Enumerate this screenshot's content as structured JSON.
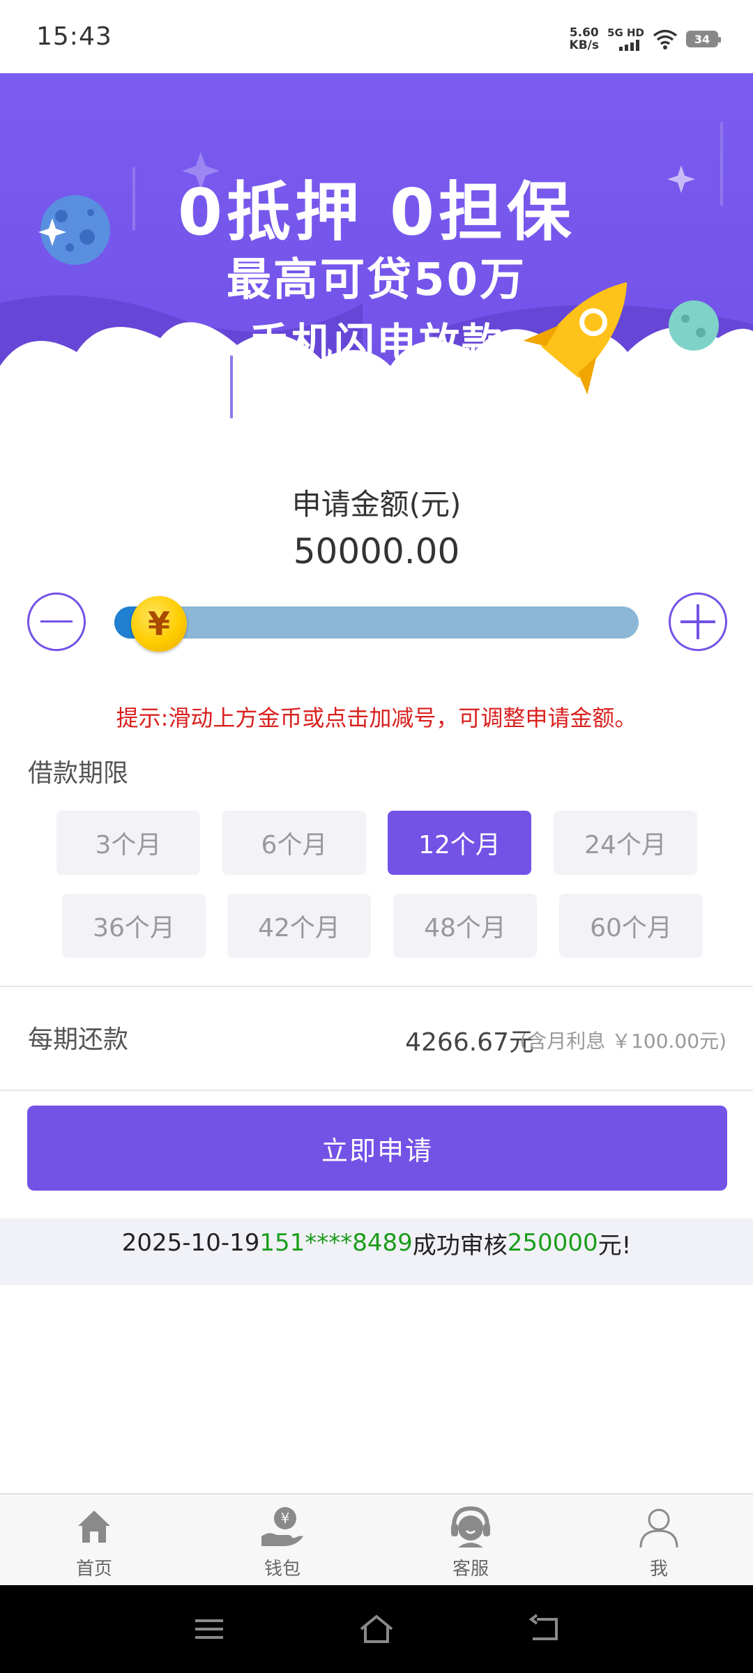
{
  "status_bar": {
    "time": "15:43",
    "net_speed_value": "5.60",
    "net_speed_unit": "KB/s",
    "signal_label": "5G HD",
    "battery": "34"
  },
  "banner": {
    "line1": "0抵押 0担保",
    "line2": "最高可贷50万",
    "line3": "手机闪电放款"
  },
  "amount": {
    "title": "申请金额(元)",
    "value": "50000.00",
    "slider_fraction": 0.0,
    "coin_symbol": "¥"
  },
  "tip": "提示:滑动上方金币或点击加减号，可调整申请金额。",
  "term": {
    "title": "借款期限",
    "options": [
      "3个月",
      "6个月",
      "12个月",
      "24个月",
      "36个月",
      "42个月",
      "48个月",
      "60个月"
    ],
    "selected": "12个月"
  },
  "payment": {
    "label": "每期还款",
    "value": "4266.67元",
    "interest": "(含月利息 ￥100.00元)"
  },
  "apply_button": "立即申请",
  "notice": {
    "date": "2025-10-19",
    "phone": "151****8489",
    "action": "成功审核",
    "amount": "250000",
    "suffix": "元!"
  },
  "tab_bar": {
    "items": [
      {
        "label": "首页",
        "icon": "home-icon"
      },
      {
        "label": "钱包",
        "icon": "wallet-icon"
      },
      {
        "label": "客服",
        "icon": "customer-service-icon"
      },
      {
        "label": "我",
        "icon": "user-icon"
      }
    ]
  },
  "colors": {
    "accent": "#7352e6",
    "tip": "#d9201e",
    "highlight_green": "#1a9d1a",
    "slider_track": "#8bb6d6",
    "coin": "#ffcc00"
  }
}
